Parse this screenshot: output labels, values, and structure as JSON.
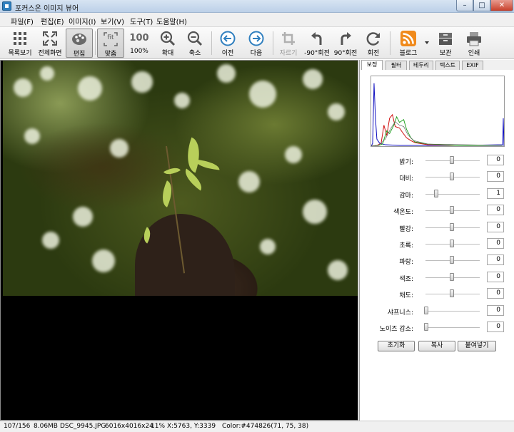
{
  "window": {
    "title": "포커스온 이미지 뷰어",
    "min_glyph": "–",
    "max_glyph": "□",
    "close_glyph": "✕"
  },
  "menu": [
    {
      "label": "파일(F)"
    },
    {
      "label": "편집(E)"
    },
    {
      "label": "이미지(I)"
    },
    {
      "label": "보기(V)"
    },
    {
      "label": "도구(T)"
    },
    {
      "label": "도움말(H)"
    }
  ],
  "toolbar": {
    "grid": "목록보기",
    "fullscreen": "전체화면",
    "edit": "편집",
    "fit": "맞춤",
    "zoom100_icon": "100",
    "zoom100": "100%",
    "zoom_in": "확대",
    "zoom_out": "축소",
    "prev": "이전",
    "next": "다음",
    "crop": "자르기",
    "rot_left": "-90°회전",
    "rot_right": "90°회전",
    "rotate": "회전",
    "blog": "블로그",
    "save": "보관",
    "print": "인쇄",
    "fit_icon_text": "fit"
  },
  "panel": {
    "tabs": [
      {
        "label": "보정"
      },
      {
        "label": "필터"
      },
      {
        "label": "테두리"
      },
      {
        "label": "텍스트"
      },
      {
        "label": "EXIF"
      }
    ],
    "sliders": [
      {
        "label": "밝기:",
        "value": "0"
      },
      {
        "label": "대비:",
        "value": "0"
      },
      {
        "label": "감마:",
        "value": "1"
      },
      {
        "label": "색온도:",
        "value": "0"
      },
      {
        "label": "빨강:",
        "value": "0"
      },
      {
        "label": "초록:",
        "value": "0"
      },
      {
        "label": "파랑:",
        "value": "0"
      },
      {
        "label": "색조:",
        "value": "0"
      },
      {
        "label": "채도:",
        "value": "0"
      },
      {
        "label": "샤프니스:",
        "value": "0"
      },
      {
        "label": "노이즈 감소:",
        "value": "0"
      }
    ],
    "buttons": {
      "reset": "초기화",
      "copy": "복사",
      "paste": "붙여넣기"
    }
  },
  "status": {
    "index": "107/156",
    "filesize": "8.06MB",
    "filename": "DSC_9945.JPG",
    "dimensions": "6016x4016x24",
    "zoom": "11%",
    "coords": "X:5763, Y:3339",
    "color": "Color:#474826(71, 75, 38)"
  },
  "colors": {
    "accent": "#2f7fbf",
    "histogram_red": "#d01010",
    "histogram_green": "#20a020",
    "histogram_blue": "#1010c0"
  }
}
